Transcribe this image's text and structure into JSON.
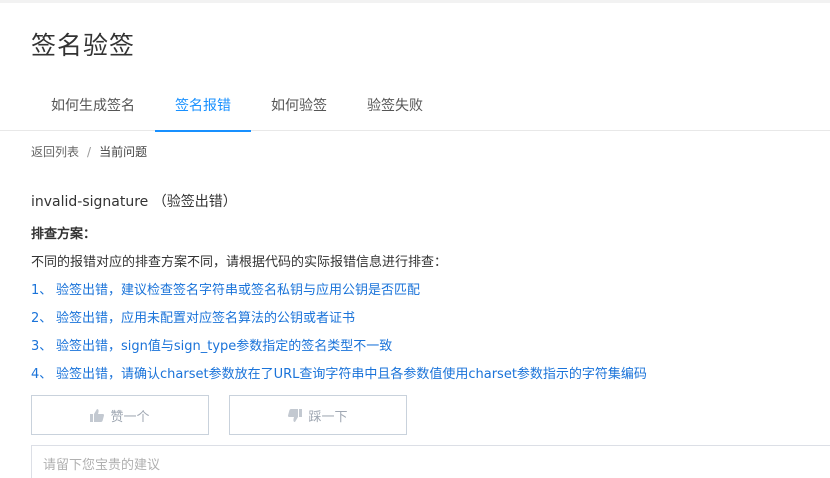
{
  "page": {
    "title": "签名验签"
  },
  "tabs": [
    {
      "label": "如何生成签名",
      "active": false
    },
    {
      "label": "签名报错",
      "active": true
    },
    {
      "label": "如何验签",
      "active": false
    },
    {
      "label": "验签失败",
      "active": false
    }
  ],
  "breadcrumb": {
    "back": "返回列表",
    "separator": "/",
    "current": "当前问题"
  },
  "issue": {
    "title": "invalid-signature （验签出错）",
    "section_label": "排查方案：",
    "intro": "不同的报错对应的排查方案不同，请根据代码的实际报错信息进行排查：",
    "items": [
      {
        "num": "1、",
        "text": "验签出错，建议检查签名字符串或签名私钥与应用公钥是否匹配"
      },
      {
        "num": "2、",
        "text": "验签出错，应用未配置对应签名算法的公钥或者证书"
      },
      {
        "num": "3、",
        "text": "验签出错，sign值与sign_type参数指定的签名类型不一致"
      },
      {
        "num": "4、",
        "text": "验签出错，请确认charset参数放在了URL查询字符串中且各参数值使用charset参数指示的字符集编码"
      }
    ]
  },
  "feedback": {
    "like_label": "赞一个",
    "dislike_label": "踩一下",
    "suggest_placeholder": "请留下您宝贵的建议"
  },
  "colors": {
    "accent": "#1890ff",
    "link": "#1a73d9",
    "button_border": "#c9d2dc",
    "button_text": "#a0a8b3"
  }
}
